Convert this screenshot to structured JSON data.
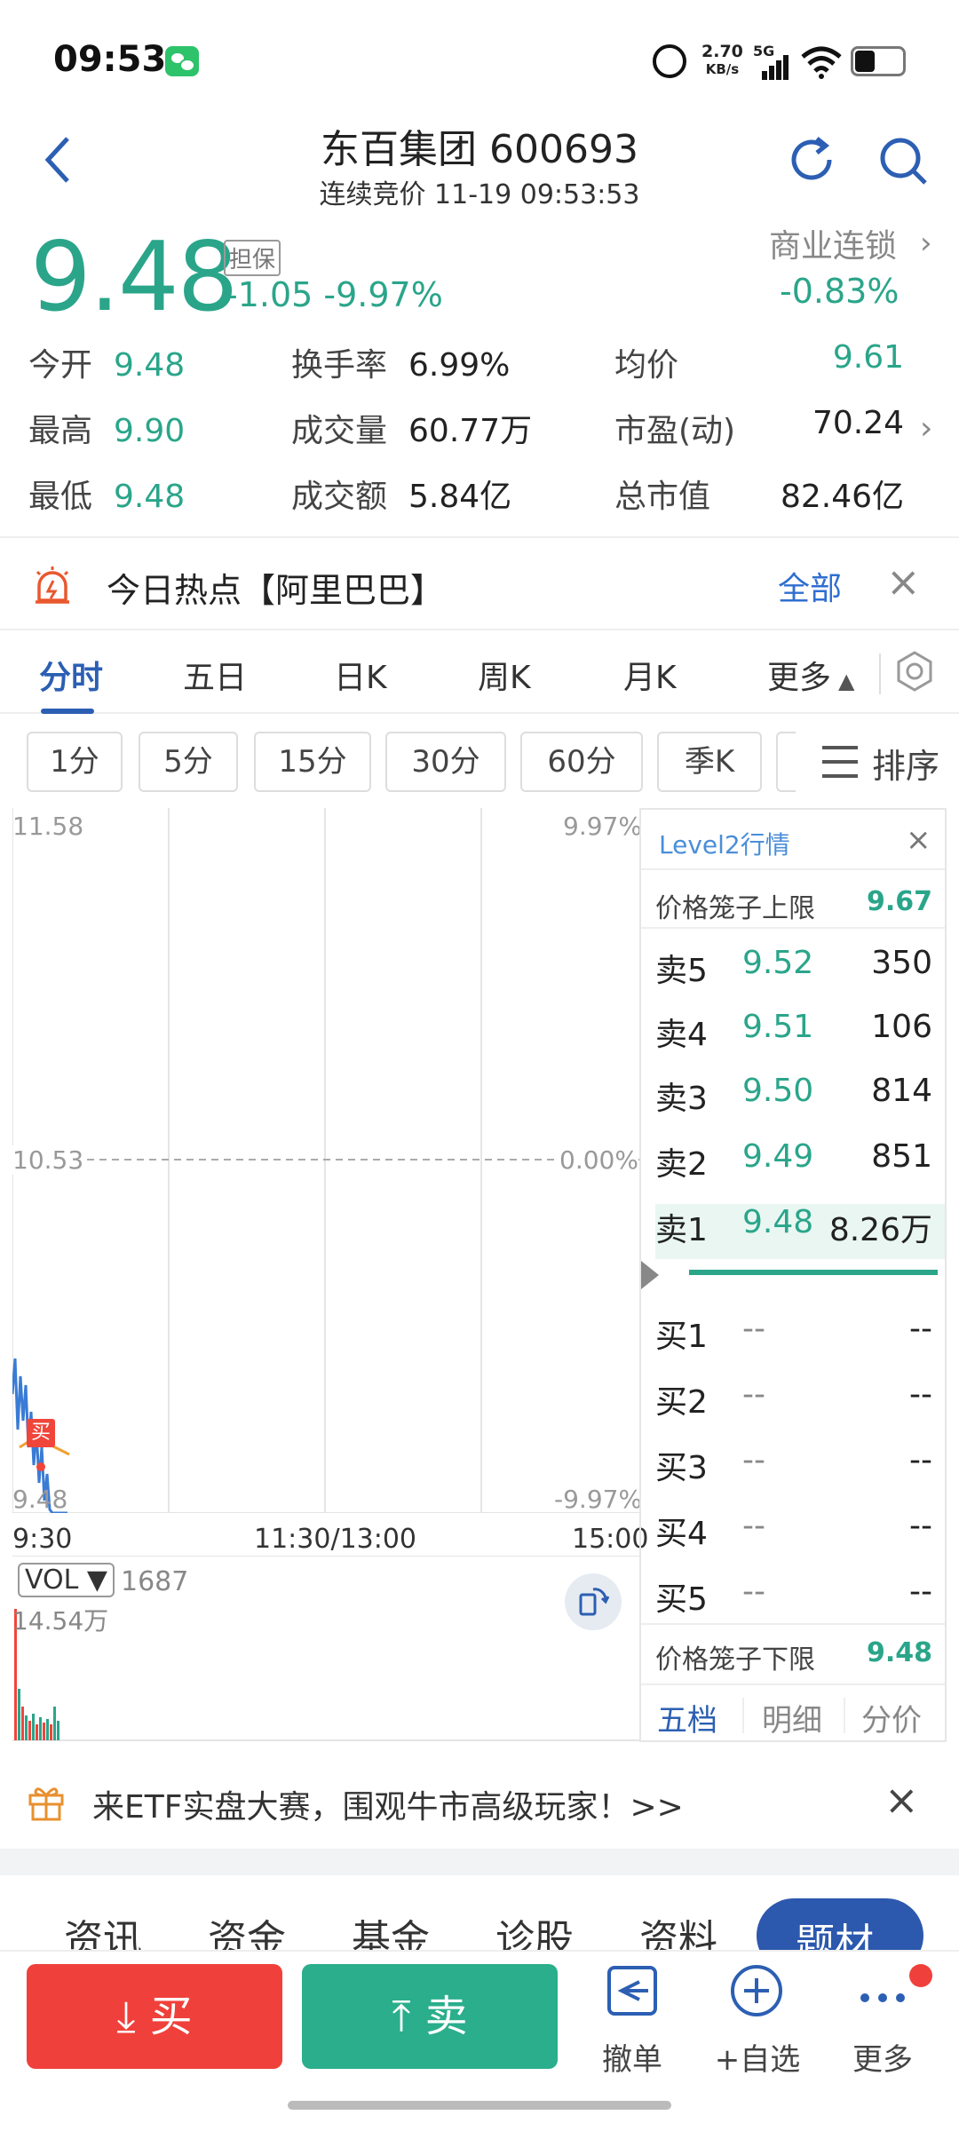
{
  "status_bar": {
    "time": "09:53",
    "net_speed": "2.70",
    "net_unit": "KB/s",
    "signal_label": "5G"
  },
  "header": {
    "title": "东百集团 600693",
    "subtitle": "连续竞价 11-19 09:53:53"
  },
  "quote": {
    "price": "9.48",
    "margin_tag": "担保",
    "change": "-1.05  -9.97%",
    "sector_name": "商业连锁",
    "sector_change": "-0.83%",
    "stats": [
      {
        "label": "今开",
        "value": "9.48",
        "color": "#2aa58a"
      },
      {
        "label": "换手率",
        "value": "6.99%"
      },
      {
        "label": "均价",
        "value": "9.61",
        "color": "#2aa58a"
      },
      {
        "label": "最高",
        "value": "9.90",
        "color": "#2aa58a"
      },
      {
        "label": "成交量",
        "value": "60.77万"
      },
      {
        "label": "市盈(动)",
        "value": "70.24"
      },
      {
        "label": "最低",
        "value": "9.48",
        "color": "#2aa58a"
      },
      {
        "label": "成交额",
        "value": "5.84亿"
      },
      {
        "label": "总市值",
        "value": "82.46亿"
      }
    ]
  },
  "hot": {
    "text": "今日热点【阿里巴巴】",
    "all_label": "全部"
  },
  "tabs": [
    "分时",
    "五日",
    "日K",
    "周K",
    "月K",
    "更多"
  ],
  "periods": [
    "1分",
    "5分",
    "15分",
    "30分",
    "60分",
    "季K"
  ],
  "sort_label": "排序",
  "chart": {
    "y_top": "11.58",
    "y_mid": "10.53",
    "y_bot": "9.48",
    "pct_top": "9.97%",
    "pct_mid": "0.00%",
    "pct_bot": "-9.97%",
    "x_start": "9:30",
    "x_mid": "11:30/13:00",
    "x_end": "15:00",
    "buy_marker": "买",
    "vol_label": "VOL ▼",
    "vol_value": "1687",
    "vol_max": "14.54万"
  },
  "order_book": {
    "title": "Level2行情",
    "upper_limit_label": "价格笼子上限",
    "upper_limit": "9.67",
    "sells": [
      {
        "label": "卖5",
        "price": "9.52",
        "vol": "350"
      },
      {
        "label": "卖4",
        "price": "9.51",
        "vol": "106"
      },
      {
        "label": "卖3",
        "price": "9.50",
        "vol": "814"
      },
      {
        "label": "卖2",
        "price": "9.49",
        "vol": "851"
      },
      {
        "label": "卖1",
        "price": "9.48",
        "vol": "8.26万"
      }
    ],
    "buys": [
      {
        "label": "买1",
        "price": "--",
        "vol": "--"
      },
      {
        "label": "买2",
        "price": "--",
        "vol": "--"
      },
      {
        "label": "买3",
        "price": "--",
        "vol": "--"
      },
      {
        "label": "买4",
        "price": "--",
        "vol": "--"
      },
      {
        "label": "买5",
        "price": "--",
        "vol": "--"
      }
    ],
    "lower_limit_label": "价格笼子下限",
    "lower_limit": "9.48",
    "tabs": [
      "五档",
      "明细",
      "分价"
    ]
  },
  "promo": {
    "text": "来ETF实盘大赛，围观牛市高级玩家！>>"
  },
  "info_tabs": [
    "资讯",
    "资金",
    "基金",
    "诊股",
    "资料",
    "题材"
  ],
  "actions": {
    "buy": "买",
    "sell": "卖",
    "cancel": "撤单",
    "watch": "+自选",
    "more": "更多"
  },
  "colors": {
    "green": "#2aa58a",
    "red": "#f0403b",
    "blue": "#2c5fb3"
  }
}
